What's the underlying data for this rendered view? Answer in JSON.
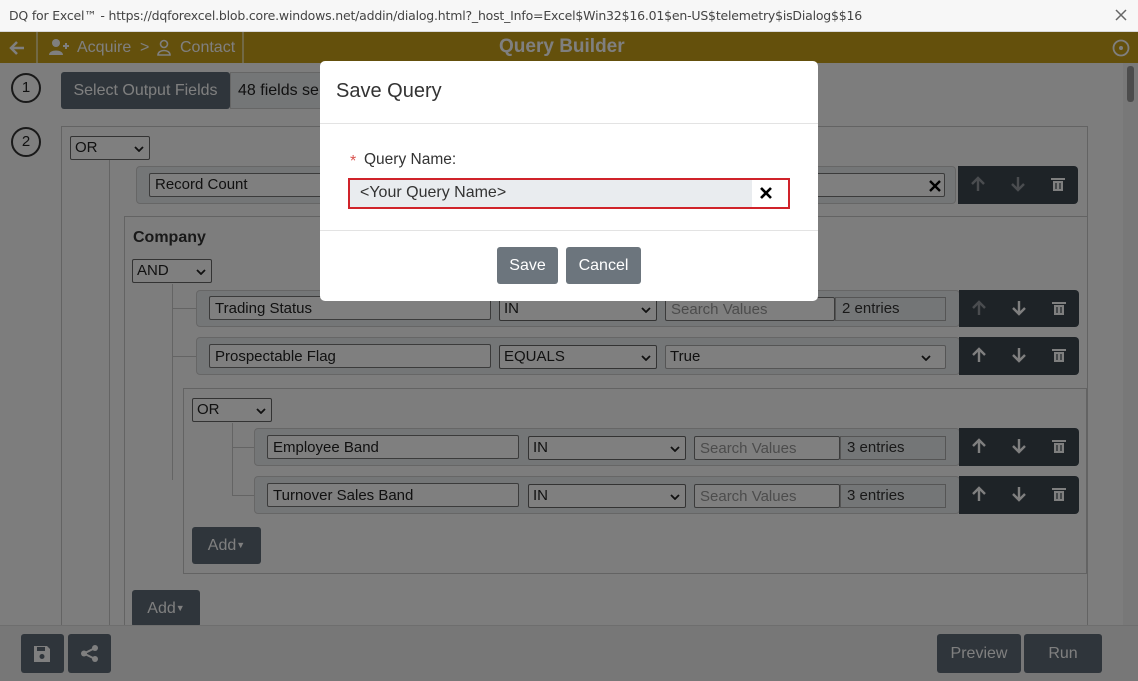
{
  "window": {
    "title": "DQ for Excel™ - https://dqforexcel.blob.core.windows.net/addin/dialog.html?_host_Info=Excel$Win32$16.01$en-US$telemetry$isDialog$$16"
  },
  "header": {
    "breadcrumb_acquire": "Acquire",
    "breadcrumb_sep": ">",
    "breadcrumb_contact": "Contact",
    "title": "Query Builder"
  },
  "steps": {
    "step1": "1",
    "step2": "2",
    "select_output_label": "Select Output Fields",
    "fields_selected": "48 fields se"
  },
  "builder": {
    "root_op": "OR",
    "record_count_field": "Record Count",
    "company_label": "Company",
    "company_op": "AND",
    "rows": [
      {
        "field": "Trading Status",
        "operator": "IN",
        "value_placeholder": "Search Values",
        "entries": "2 entries"
      },
      {
        "field": "Prospectable Flag",
        "operator": "EQUALS",
        "value": "True"
      }
    ],
    "nested_op": "OR",
    "nested_rows": [
      {
        "field": "Employee Band",
        "operator": "IN",
        "value_placeholder": "Search Values",
        "entries": "3 entries"
      },
      {
        "field": "Turnover Sales Band",
        "operator": "IN",
        "value_placeholder": "Search Values",
        "entries": "3 entries"
      }
    ],
    "add_label": "Add"
  },
  "footer": {
    "preview_label": "Preview",
    "run_label": "Run"
  },
  "modal": {
    "title": "Save Query",
    "required_mark": "*",
    "field_label": "Query Name:",
    "input_value": "<Your Query Name>",
    "save_label": "Save",
    "cancel_label": "Cancel"
  },
  "colors": {
    "header_bg": "#c9a019",
    "highlight_border": "#d0232a",
    "button_gray": "#6c757d",
    "control_dark": "#3d464f"
  },
  "icons": [
    "back-arrow-icon",
    "add-user-icon",
    "user-icon",
    "help-icon",
    "close-icon",
    "caret-down-icon",
    "arrow-up-icon",
    "arrow-down-icon",
    "trash-icon",
    "save-icon",
    "share-icon",
    "clear-icon"
  ]
}
